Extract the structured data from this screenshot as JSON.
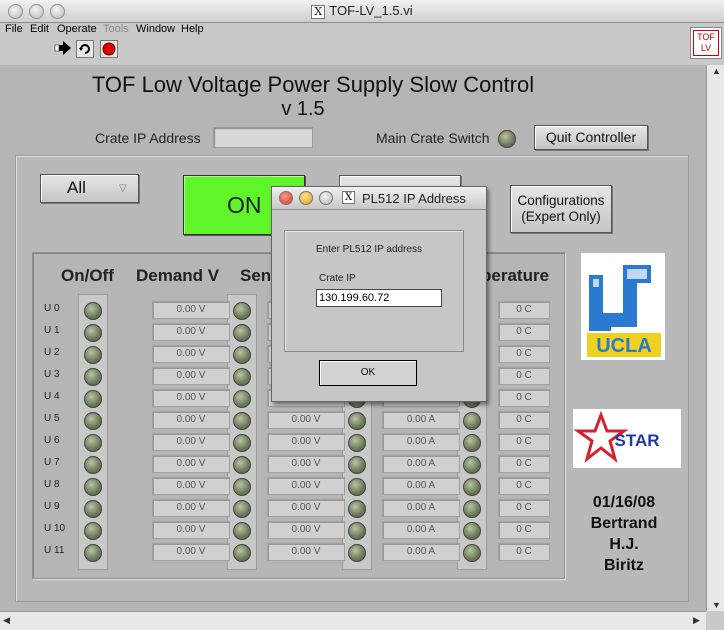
{
  "window": {
    "title": "TOF-LV_1.5.vi",
    "x_glyph": "X"
  },
  "menu": [
    "File",
    "Edit",
    "Operate",
    "Tools",
    "Window",
    "Help"
  ],
  "badge": {
    "line1": "TOF",
    "line2": "LV"
  },
  "header": {
    "title": "TOF Low Voltage Power Supply Slow Control",
    "version": "v 1.5",
    "crate_ip_label": "Crate IP Address",
    "crate_ip_value": "",
    "main_switch_label": "Main Crate Switch",
    "quit_label": "Quit Controller"
  },
  "controls": {
    "selector_value": "All",
    "on_label": "ON",
    "config_label_1": "Configurations",
    "config_label_2": "(Expert Only)"
  },
  "columns": {
    "onoff": "On/Off",
    "demand": "Demand V",
    "sense": "Sen",
    "temperature": "perature"
  },
  "rows": [
    {
      "label": "U 0",
      "demand": "0.00 V",
      "sense": "",
      "current": "",
      "temp": "0 C"
    },
    {
      "label": "U 1",
      "demand": "0.00 V",
      "sense": "",
      "current": "",
      "temp": "0 C"
    },
    {
      "label": "U 2",
      "demand": "0.00 V",
      "sense": "",
      "current": "",
      "temp": "0 C"
    },
    {
      "label": "U 3",
      "demand": "0.00 V",
      "sense": "",
      "current": "",
      "temp": "0 C"
    },
    {
      "label": "U 4",
      "demand": "0.00 V",
      "sense": "",
      "current": "",
      "temp": "0 C"
    },
    {
      "label": "U 5",
      "demand": "0.00 V",
      "sense": "0.00 V",
      "current": "0.00 A",
      "temp": "0 C"
    },
    {
      "label": "U 6",
      "demand": "0.00 V",
      "sense": "0.00 V",
      "current": "0.00 A",
      "temp": "0 C"
    },
    {
      "label": "U 7",
      "demand": "0.00 V",
      "sense": "0.00 V",
      "current": "0.00 A",
      "temp": "0 C"
    },
    {
      "label": "U 8",
      "demand": "0.00 V",
      "sense": "0.00 V",
      "current": "0.00 A",
      "temp": "0 C"
    },
    {
      "label": "U 9",
      "demand": "0.00 V",
      "sense": "0.00 V",
      "current": "0.00 A",
      "temp": "0 C"
    },
    {
      "label": "U 10",
      "demand": "0.00 V",
      "sense": "0.00 V",
      "current": "0.00 A",
      "temp": "0 C"
    },
    {
      "label": "U 11",
      "demand": "0.00 V",
      "sense": "0.00 V",
      "current": "0.00 A",
      "temp": "0 C"
    }
  ],
  "logos": {
    "ucla": "UCLA",
    "star": "STAR"
  },
  "credits": {
    "date": "01/16/08",
    "line1": "Bertrand",
    "line2": "H.J.",
    "line3": "Biritz"
  },
  "dialog": {
    "title": "PL512 IP Address",
    "prompt": "Enter PL512 IP address",
    "field_label": "Crate IP",
    "field_value": "130.199.60.72",
    "ok_label": "OK"
  },
  "colors": {
    "on_green": "#5ff52a",
    "led_green": "#6c7a5a",
    "ucla_blue": "#2a7bd0",
    "ucla_gold": "#f0d21e",
    "star_red": "#d8202a",
    "star_blue": "#1a3aa8"
  }
}
